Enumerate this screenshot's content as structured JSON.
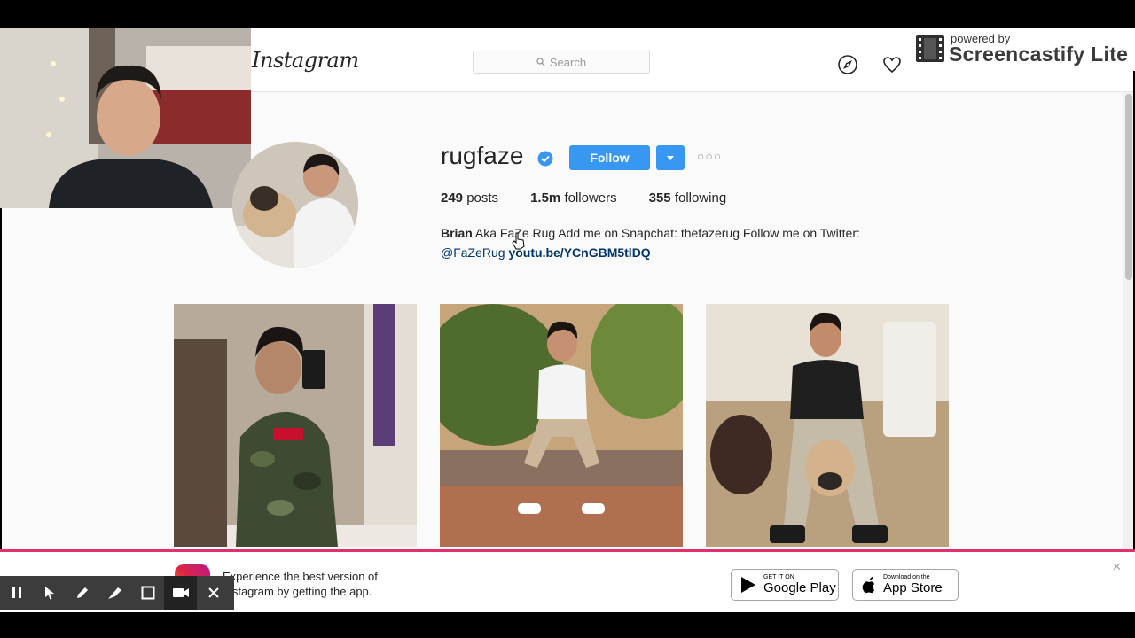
{
  "nav": {
    "logo": "Instagram",
    "search_placeholder": "Search"
  },
  "recorder_brand": {
    "powered_by": "powered by",
    "name": "Screencastify Lite"
  },
  "profile": {
    "username": "rugfaze",
    "follow_label": "Follow",
    "stats": {
      "posts_count": "249",
      "posts_label": "posts",
      "followers_count": "1.5m",
      "followers_label": "followers",
      "following_count": "355",
      "following_label": "following"
    },
    "bio": {
      "name": "Brian",
      "text": "Aka FaZe Rug Add me on Snapchat: thefazerug Follow me on Twitter:",
      "mention": "@FaZeRug",
      "link": "youtu.be/YCnGBM5tlDQ"
    }
  },
  "app_banner": {
    "line1": "Experience the best version of",
    "line2": "Instagram by getting the app.",
    "google_small": "GET IT ON",
    "google_big": "Google Play",
    "apple_small": "Download on the",
    "apple_big": "App Store"
  },
  "colors": {
    "accent": "#3897f0",
    "banner_border": "#e1306c"
  }
}
